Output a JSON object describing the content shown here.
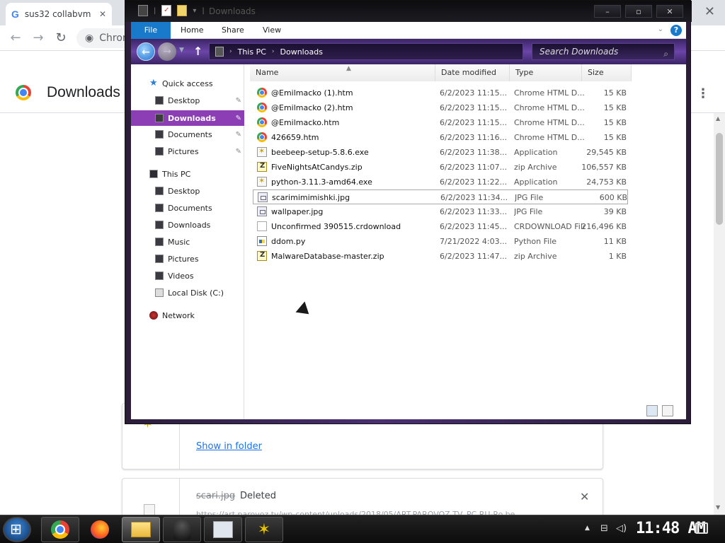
{
  "chrome": {
    "tab_title": "sus32 collabvm",
    "tab_icon": "G",
    "omnibox_text": "Chrom",
    "page_title": "Downloads",
    "card1_link": "Show in folder",
    "card2_name": "scari.jpg",
    "card2_status": "Deleted",
    "card2_url": "https://art.parovoz.tv/wp-content/uploads/2018/05/ART.PAROVOZ.TV_PC.RU-Ro.be..."
  },
  "explorer": {
    "window_title": "Downloads",
    "ribbon": {
      "file": "File",
      "home": "Home",
      "share": "Share",
      "view": "View",
      "help": "?"
    },
    "breadcrumb": [
      "This PC",
      "Downloads"
    ],
    "search_placeholder": "Search Downloads",
    "nav": {
      "quick_access": "Quick access",
      "qa_items": [
        "Desktop",
        "Downloads",
        "Documents",
        "Pictures"
      ],
      "this_pc": "This PC",
      "pc_items": [
        "Desktop",
        "Documents",
        "Downloads",
        "Music",
        "Pictures",
        "Videos",
        "Local Disk (C:)"
      ],
      "network": "Network"
    },
    "columns": {
      "name": "Name",
      "date": "Date modified",
      "type": "Type",
      "size": "Size"
    },
    "files": [
      {
        "name": "@Emilmacko (1).htm",
        "date": "6/2/2023 11:15...",
        "type": "Chrome HTML D...",
        "size": "15 KB",
        "icon": "chrome"
      },
      {
        "name": "@Emilmacko (2).htm",
        "date": "6/2/2023 11:15...",
        "type": "Chrome HTML D...",
        "size": "15 KB",
        "icon": "chrome"
      },
      {
        "name": "@Emilmacko.htm",
        "date": "6/2/2023 11:15...",
        "type": "Chrome HTML D...",
        "size": "15 KB",
        "icon": "chrome"
      },
      {
        "name": "426659.htm",
        "date": "6/2/2023 11:16...",
        "type": "Chrome HTML D...",
        "size": "15 KB",
        "icon": "chrome"
      },
      {
        "name": "beebeep-setup-5.8.6.exe",
        "date": "6/2/2023 11:38...",
        "type": "Application",
        "size": "29,545 KB",
        "icon": "exe"
      },
      {
        "name": "FiveNightsAtCandys.zip",
        "date": "6/2/2023 11:07...",
        "type": "zip Archive",
        "size": "106,557 KB",
        "icon": "zip"
      },
      {
        "name": "python-3.11.3-amd64.exe",
        "date": "6/2/2023 11:22...",
        "type": "Application",
        "size": "24,753 KB",
        "icon": "exe"
      },
      {
        "name": "scarimimimishki.jpg",
        "date": "6/2/2023 11:34...",
        "type": "JPG File",
        "size": "600 KB",
        "icon": "img"
      },
      {
        "name": "wallpaper.jpg",
        "date": "6/2/2023 11:33...",
        "type": "JPG File",
        "size": "39 KB",
        "icon": "img"
      },
      {
        "name": "Unconfirmed 390515.crdownload",
        "date": "6/2/2023 11:45...",
        "type": "CRDOWNLOAD File",
        "size": "216,496 KB",
        "icon": "doc"
      },
      {
        "name": "ddom.py",
        "date": "7/21/2022 4:03...",
        "type": "Python File",
        "size": "11 KB",
        "icon": "py"
      },
      {
        "name": "MalwareDatabase-master.zip",
        "date": "6/2/2023 11:47...",
        "type": "zip Archive",
        "size": "1 KB",
        "icon": "zip"
      }
    ],
    "selected_index": 7
  },
  "taskbar": {
    "clock": "11:48 AM"
  }
}
